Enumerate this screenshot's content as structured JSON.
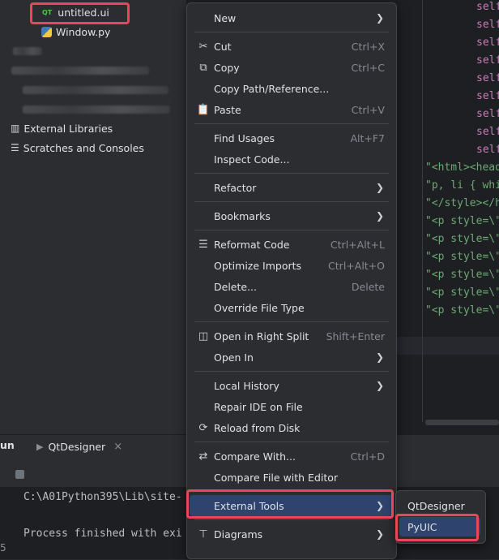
{
  "project_tree": {
    "file_ui": "untitled.ui",
    "file_ui_icon": "QT",
    "file_py": "Window.py",
    "external_libraries": "External Libraries",
    "scratches": "Scratches and Consoles"
  },
  "editor": {
    "self_token": "self",
    "string_lines": [
      "\"<html><head>",
      "\"p, li { whi",
      "\"</style></h",
      "\"<p style=\\\"",
      "\"<p style=\\\"",
      "\"<p style=\\\"",
      "\"<p style=\\\"",
      "\"<p style=\\\"",
      "\"<p style=\\\""
    ]
  },
  "bottom_panel": {
    "run_tab": "un",
    "qtdesigner_tab": "QtDesigner",
    "close_glyph": "×",
    "console_line_1": "C:\\A01Python395\\Lib\\site-",
    "console_line_2": "Process finished with exi",
    "gutter_digit": "5"
  },
  "context_menu": {
    "new": "New",
    "cut": "Cut",
    "cut_shortcut": "Ctrl+X",
    "copy": "Copy",
    "copy_shortcut": "Ctrl+C",
    "copy_path": "Copy Path/Reference...",
    "paste": "Paste",
    "paste_shortcut": "Ctrl+V",
    "find_usages": "Find Usages",
    "find_usages_shortcut": "Alt+F7",
    "inspect_code": "Inspect Code...",
    "refactor": "Refactor",
    "bookmarks": "Bookmarks",
    "reformat_code": "Reformat Code",
    "reformat_code_shortcut": "Ctrl+Alt+L",
    "optimize_imports": "Optimize Imports",
    "optimize_imports_shortcut": "Ctrl+Alt+O",
    "delete": "Delete...",
    "delete_shortcut": "Delete",
    "override_file_type": "Override File Type",
    "open_right_split": "Open in Right Split",
    "open_right_split_shortcut": "Shift+Enter",
    "open_in": "Open In",
    "local_history": "Local History",
    "repair_ide": "Repair IDE on File",
    "reload_disk": "Reload from Disk",
    "compare_with": "Compare With...",
    "compare_with_shortcut": "Ctrl+D",
    "compare_file_editor": "Compare File with Editor",
    "external_tools": "External Tools",
    "diagrams": "Diagrams"
  },
  "submenu": {
    "qtdesigner": "QtDesigner",
    "pyuic": "PyUIC"
  },
  "colors": {
    "selection": "#2e436e",
    "annotation_red": "#e8475a"
  }
}
